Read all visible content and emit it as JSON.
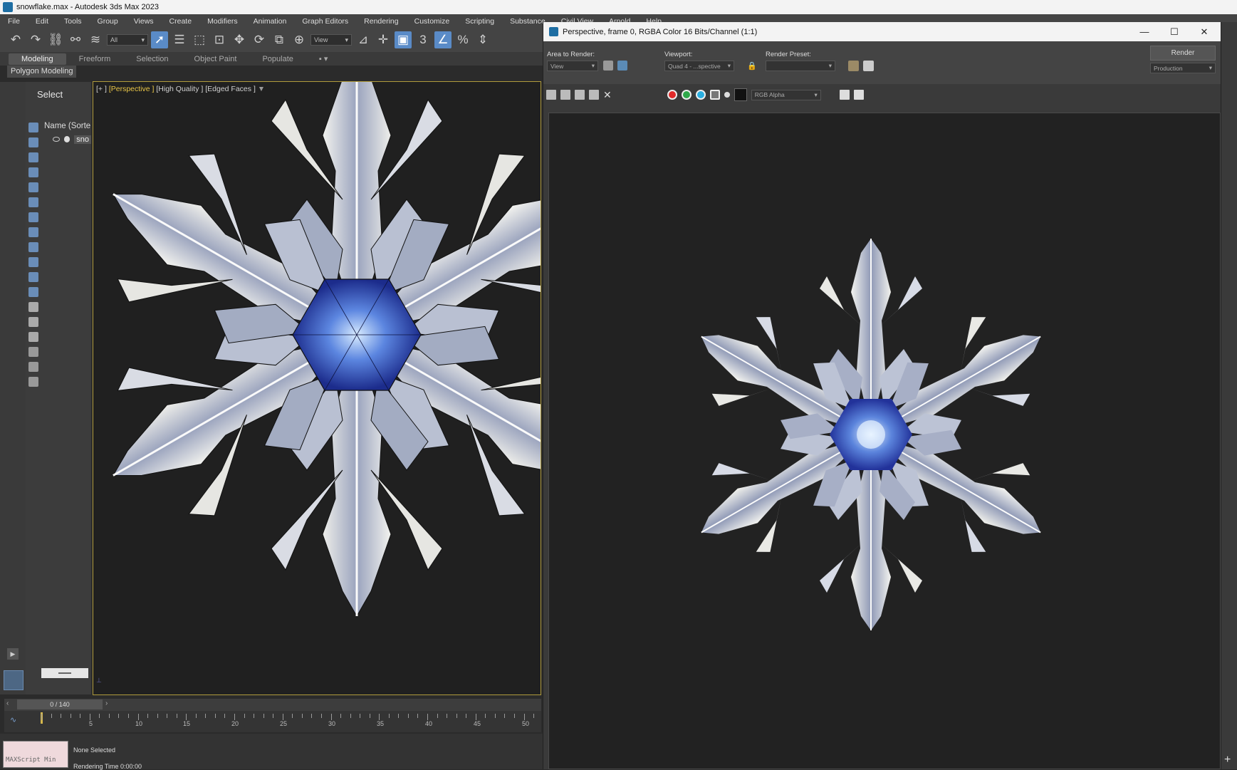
{
  "window": {
    "title": "snowflake.max - Autodesk 3ds Max 2023"
  },
  "menu": {
    "items": [
      "File",
      "Edit",
      "Tools",
      "Group",
      "Views",
      "Create",
      "Modifiers",
      "Animation",
      "Graph Editors",
      "Rendering",
      "Customize",
      "Scripting",
      "Substance",
      "Civil View",
      "Arnold",
      "Help"
    ]
  },
  "toolbar": {
    "selection_filter": "All",
    "ref_coord": "View"
  },
  "ribbon": {
    "tabs": [
      "Modeling",
      "Freeform",
      "Selection",
      "Object Paint",
      "Populate"
    ],
    "active_tab": "Modeling",
    "sub_label": "Polygon Modeling"
  },
  "explorer": {
    "title": "Select",
    "column_header": "Name (Sorte",
    "object_name": "sno"
  },
  "viewport": {
    "label_plus": "[+ ]",
    "label_view": "[Perspective ]",
    "label_shading": "[High Quality ]",
    "label_edges": "[Edged Faces ]"
  },
  "timeline": {
    "frame_display": "0 / 140",
    "tick_labels": [
      "5",
      "10",
      "15",
      "20",
      "25",
      "30",
      "35",
      "40",
      "45",
      "50"
    ]
  },
  "status": {
    "maxscript": "MAXScript Min",
    "selection": "None Selected",
    "render_time": "Rendering Time  0:00:00"
  },
  "render_window": {
    "title": "Perspective, frame 0, RGBA Color 16 Bits/Channel (1:1)",
    "area_label": "Area to Render:",
    "area_value": "View",
    "viewport_label": "Viewport:",
    "viewport_value": "Quad 4 - ...spective",
    "preset_label": "Render Preset:",
    "preset_value": "",
    "render_button": "Render",
    "mode_value": "Production",
    "channel_value": "RGB Alpha"
  },
  "colors": {
    "viewport_border": "#b09b3c",
    "accent": "#5a8bc7",
    "perspective_label": "#e8c547"
  }
}
